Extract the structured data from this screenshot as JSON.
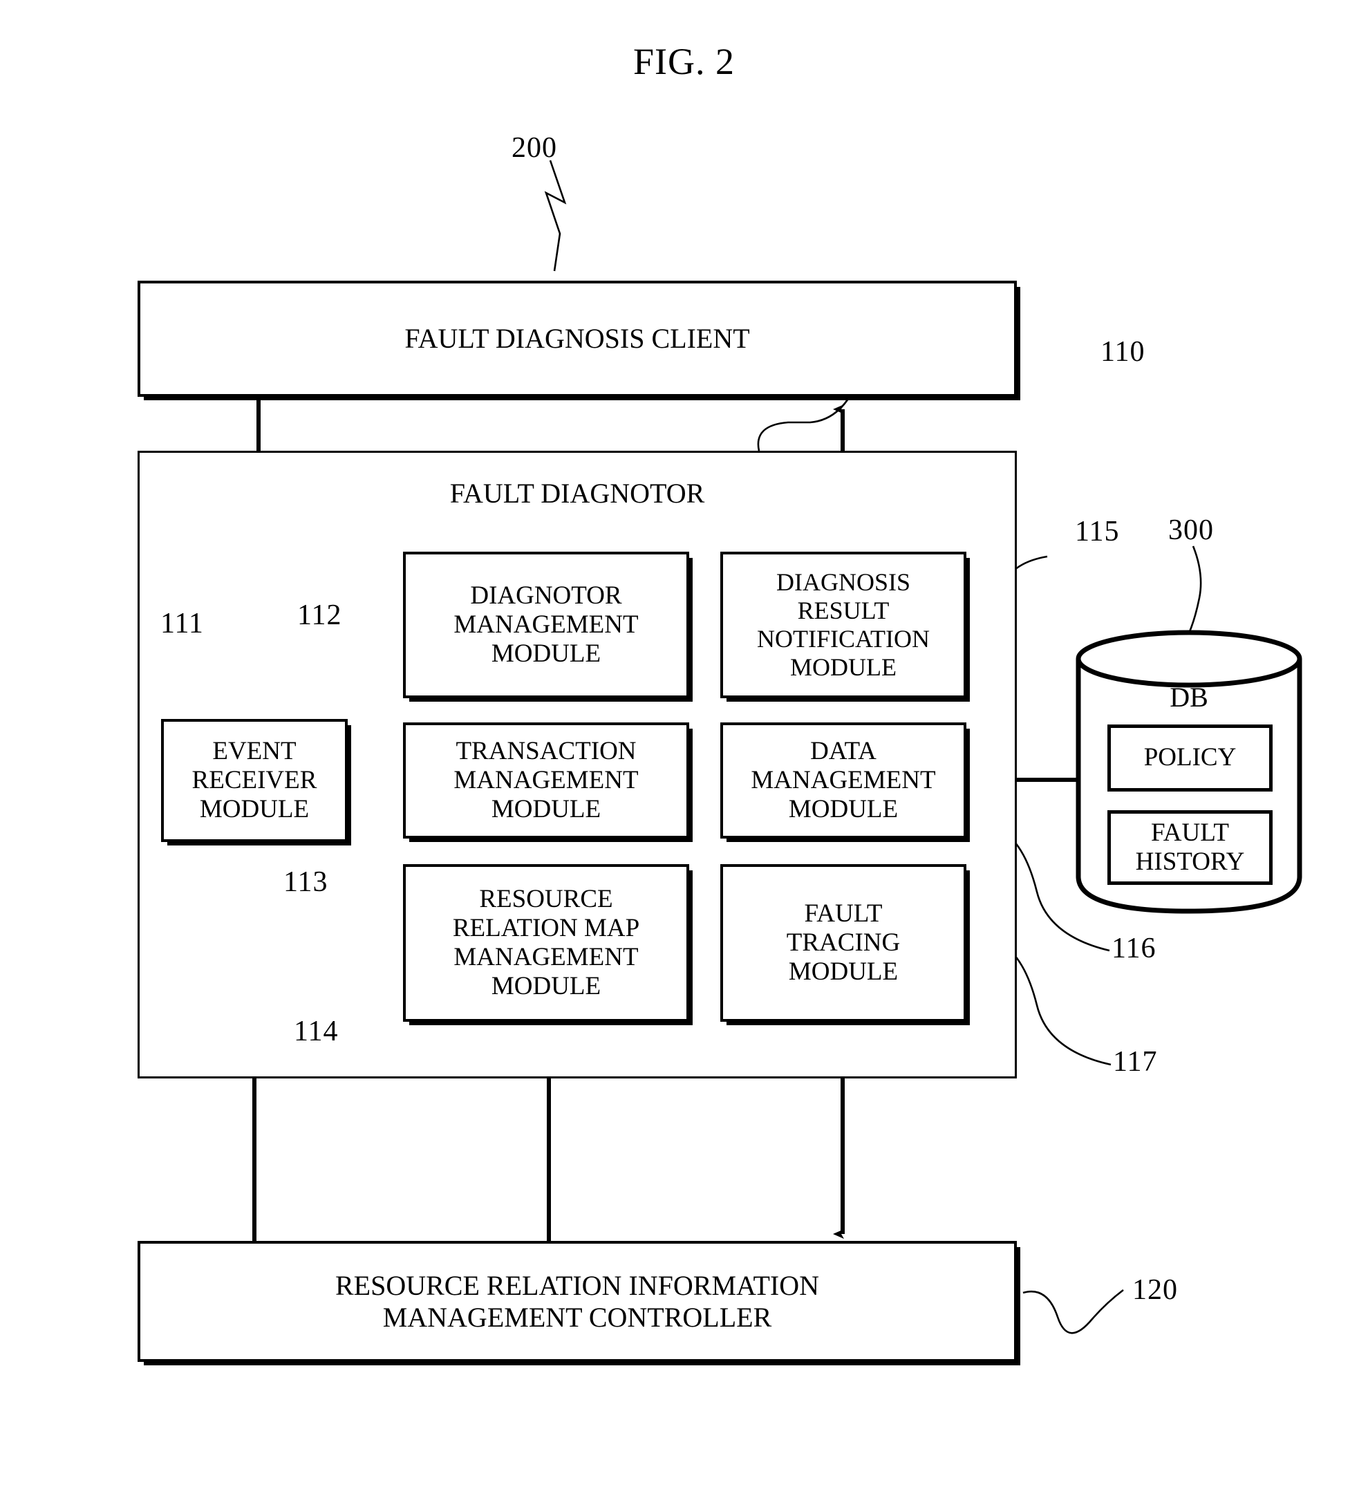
{
  "figure": {
    "title": "FIG. 2"
  },
  "blocks": {
    "client": {
      "label": "FAULT DIAGNOSIS CLIENT",
      "ref": "200"
    },
    "diagnotor": {
      "label": "FAULT DIAGNOTOR",
      "ref": "110"
    },
    "event_receiver": {
      "label": "EVENT\nRECEIVER\nMODULE",
      "line1": "EVENT",
      "line2": "RECEIVER",
      "line3": "MODULE",
      "ref": "111"
    },
    "diagnotor_management": {
      "line1": "DIAGNOTOR",
      "line2": "MANAGEMENT",
      "line3": "MODULE",
      "ref": "112"
    },
    "transaction_management": {
      "line1": "TRANSACTION",
      "line2": "MANAGEMENT",
      "line3": "MODULE",
      "ref": "113"
    },
    "resource_relation_map_management": {
      "line1": "RESOURCE",
      "line2": "RELATION MAP",
      "line3": "MANAGEMENT",
      "line4": "MODULE",
      "ref": "114"
    },
    "diagnosis_result_notification": {
      "line1": "DIAGNOSIS",
      "line2": "RESULT",
      "line3": "NOTIFICATION",
      "line4": "MODULE",
      "ref": "115"
    },
    "data_management": {
      "line1": "DATA",
      "line2": "MANAGEMENT",
      "line3": "MODULE",
      "ref": "116"
    },
    "fault_tracing": {
      "line1": "FAULT",
      "line2": "TRACING",
      "line3": "MODULE",
      "ref": "117"
    },
    "controller": {
      "line1": "RESOURCE RELATION INFORMATION",
      "line2": "MANAGEMENT CONTROLLER",
      "ref": "120"
    },
    "db": {
      "label": "DB",
      "ref": "300",
      "policy": "POLICY",
      "fault_history_line1": "FAULT",
      "fault_history_line2": "HISTORY"
    }
  },
  "colors": {
    "ink": "#000000",
    "paper": "#ffffff"
  }
}
